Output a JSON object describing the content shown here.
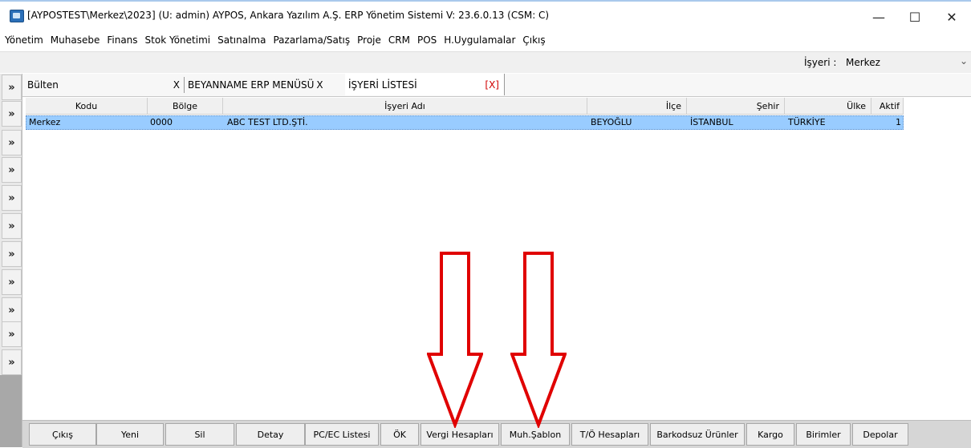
{
  "window": {
    "title": "[AYPOSTEST\\Merkez\\2023] (U: admin) AYPOS, Ankara Yazılım A.Ş. ERP Yönetim Sistemi V: 23.6.0.13 (CSM: C)",
    "minimize": "—",
    "maximize": "☐",
    "close": "✕"
  },
  "menu": [
    "Yönetim",
    "Muhasebe",
    "Finans",
    "Stok Yönetimi",
    "Satınalma",
    "Pazarlama/Satış",
    "Proje",
    "CRM",
    "POS",
    "H.Uygulamalar",
    "Çıkış"
  ],
  "isyeri": {
    "label": "İşyeri :",
    "value": "Merkez",
    "chevron": "⌄"
  },
  "left_buttons": [
    "»",
    "»",
    "»",
    "»",
    "»",
    "»",
    "»",
    "»",
    "»",
    "»",
    "»"
  ],
  "tabs": [
    {
      "label": "Bülten",
      "close": "X"
    },
    {
      "label": "BEYANNAME ERP MENÜSÜ",
      "close": "X"
    },
    {
      "label": "İŞYERİ LİSTESİ",
      "close": "[X]"
    }
  ],
  "table": {
    "headers": [
      "Kodu",
      "Bölge",
      "İşyeri Adı",
      "İlçe",
      "Şehir",
      "Ülke",
      "Aktif"
    ],
    "rows": [
      [
        "Merkez",
        "0000",
        "ABC TEST LTD.ŞTİ.",
        "BEYOĞLU",
        "İSTANBUL",
        "TÜRKİYE",
        "1"
      ]
    ]
  },
  "bottom_buttons": [
    "Çıkış",
    "Yeni",
    "Sil",
    "Detay",
    "PC/EC Listesi",
    "ÖK",
    "Vergi Hesapları",
    "Muh.Şablon",
    "T/Ö Hesapları",
    "Barkodsuz Ürünler",
    "Kargo",
    "Birimler",
    "Depolar"
  ],
  "colors": {
    "selected_row": "#99ccff",
    "arrow": "#e00000",
    "tab_close_active": "#d00000"
  },
  "annotations": [
    {
      "name": "red-arrow-down",
      "target": "Vergi Hesapları"
    },
    {
      "name": "red-arrow-down",
      "target": "Muh.Şablon"
    }
  ]
}
